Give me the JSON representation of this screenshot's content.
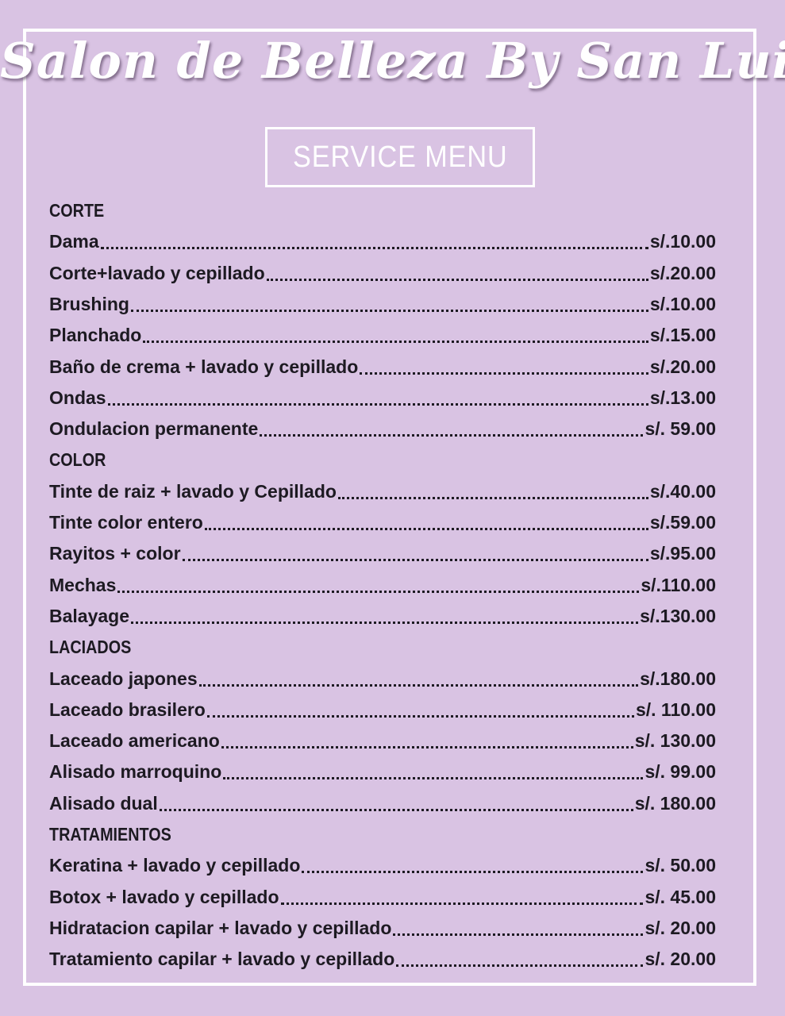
{
  "title": "Salon de Belleza By San Luis",
  "subtitle": "SERVICE MENU",
  "sections": [
    {
      "heading": "CORTE",
      "items": [
        {
          "name": "Dama",
          "price": "s/.10.00"
        },
        {
          "name": "Corte+lavado y cepillado",
          "price": "s/.20.00"
        },
        {
          "name": "Brushing",
          "price": "s/.10.00"
        },
        {
          "name": "Planchado",
          "price": "s/.15.00"
        },
        {
          "name": "Baño de crema + lavado y cepillado",
          "price": "s/.20.00"
        },
        {
          "name": "Ondas",
          "price": "s/.13.00"
        },
        {
          "name": "Ondulacion permanente",
          "price": "s/. 59.00"
        }
      ]
    },
    {
      "heading": "COLOR",
      "items": [
        {
          "name": "Tinte de raiz + lavado y Cepillado",
          "price": "s/.40.00"
        },
        {
          "name": "Tinte color entero",
          "price": "s/.59.00"
        },
        {
          "name": "Rayitos + color",
          "price": "s/.95.00"
        },
        {
          "name": "Mechas",
          "price": "s/.110.00"
        },
        {
          "name": "Balayage",
          "price": "s/.130.00"
        }
      ]
    },
    {
      "heading": "LACIADOS",
      "items": [
        {
          "name": "Laceado japones",
          "price": "s/.180.00"
        },
        {
          "name": "Laceado brasilero",
          "price": "s/. 110.00"
        },
        {
          "name": "Laceado americano",
          "price": "s/. 130.00"
        },
        {
          "name": "Alisado marroquino",
          "price": "s/. 99.00"
        },
        {
          "name": "Alisado dual",
          "price": "s/. 180.00"
        }
      ]
    },
    {
      "heading": "TRATAMIENTOS",
      "items": [
        {
          "name": "Keratina + lavado y cepillado",
          "price": "s/. 50.00"
        },
        {
          "name": "Botox + lavado y cepillado",
          "price": "s/. 45.00"
        },
        {
          "name": "Hidratacion capilar + lavado y cepillado",
          "price": "s/. 20.00"
        },
        {
          "name": "Tratamiento capilar + lavado y cepillado",
          "price": "s/. 20.00"
        }
      ]
    }
  ],
  "colors": {
    "background": "#d9c3e3",
    "frame": "#ffffff",
    "text": "#1d1a22"
  }
}
